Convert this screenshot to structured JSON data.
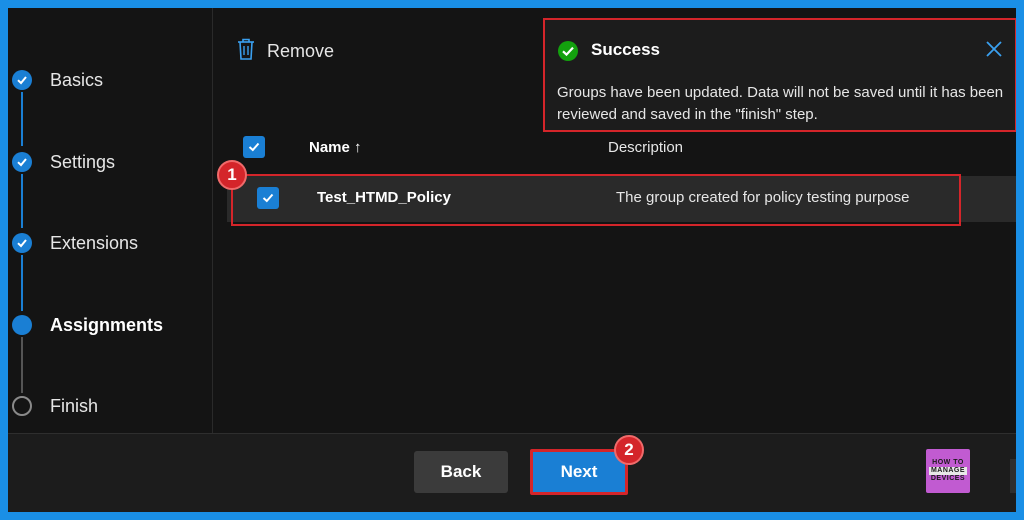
{
  "wizard": {
    "steps": [
      {
        "label": "Basics",
        "state": "done"
      },
      {
        "label": "Settings",
        "state": "done"
      },
      {
        "label": "Extensions",
        "state": "done"
      },
      {
        "label": "Assignments",
        "state": "current"
      },
      {
        "label": "Finish",
        "state": "pending"
      }
    ]
  },
  "toolbar": {
    "remove_label": "Remove",
    "remove_icon": "trash-icon"
  },
  "toast": {
    "title": "Success",
    "message": "Groups have been updated. Data will not be saved until it has been reviewed and saved in the \"finish\" step.",
    "status_color": "#13a10e",
    "close_icon": "close-icon"
  },
  "table": {
    "columns": {
      "name": "Name ↑",
      "description": "Description"
    },
    "rows": [
      {
        "name": "Test_HTMD_Policy",
        "description": "The group created for policy testing purpose"
      }
    ]
  },
  "annotations": {
    "badge_1": "1",
    "badge_2": "2",
    "color": "#d4252a"
  },
  "footer": {
    "back_label": "Back",
    "next_label": "Next",
    "accent": "#1a7fd4"
  },
  "logo": {
    "line1": "HOW TO",
    "line2": "MANAGE",
    "line3": "DEVICES"
  }
}
